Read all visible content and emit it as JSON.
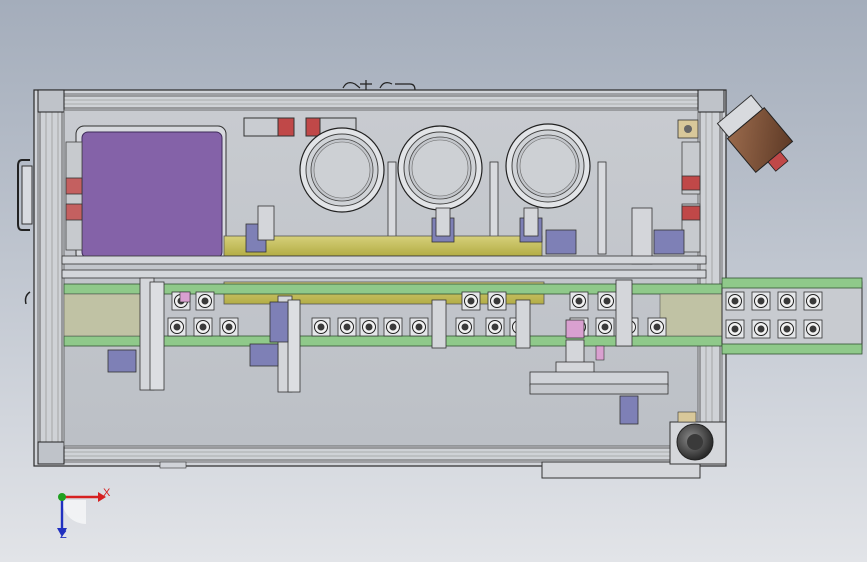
{
  "viewer": {
    "background_top": "#a4adbb",
    "background_bottom": "#e2e4e8"
  },
  "model": {
    "frame_color": "#c8ccd2",
    "plate_color": "#c3c6cb",
    "purple_panel_color": "#8462a8",
    "rail_color": "#c9c35a",
    "conveyor_color": "#8fc98a",
    "motor_color": "#7a5038",
    "bracket_color": "#7e80b6",
    "fixture_color": "#d9a0d0",
    "drum_count": 3,
    "conveyor_pocket_rows": 2
  },
  "triad": {
    "x_label": "X",
    "z_label": "Z",
    "x_color": "#d62020",
    "y_color": "#20a020",
    "z_color": "#2030c0"
  }
}
